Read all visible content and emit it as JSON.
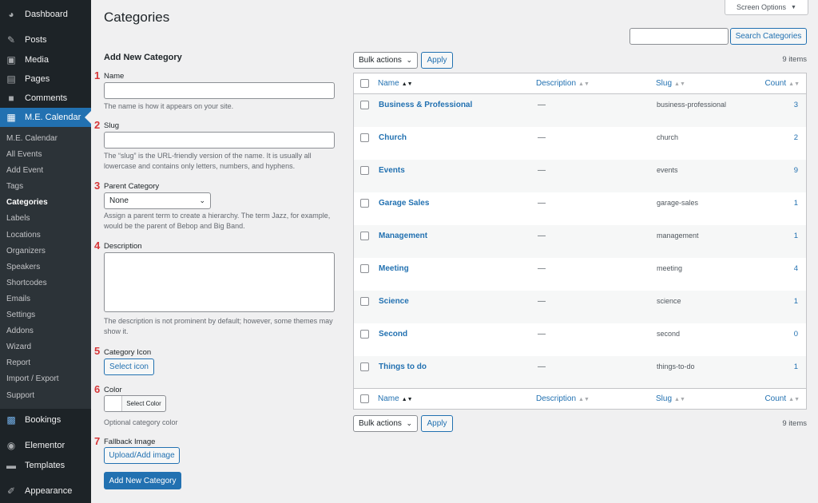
{
  "sidebar": {
    "top_items": [
      {
        "label": "Dashboard",
        "icon": "dashboard-icon"
      },
      {
        "label": "Posts",
        "icon": "pin-icon"
      },
      {
        "label": "Media",
        "icon": "media-icon"
      },
      {
        "label": "Pages",
        "icon": "pages-icon"
      },
      {
        "label": "Comments",
        "icon": "comment-icon"
      },
      {
        "label": "M.E. Calendar",
        "icon": "calendar-icon"
      }
    ],
    "sub_items": [
      "M.E. Calendar",
      "All Events",
      "Add Event",
      "Tags",
      "Categories",
      "Labels",
      "Locations",
      "Organizers",
      "Speakers",
      "Shortcodes",
      "Emails",
      "Settings",
      "Addons",
      "Wizard",
      "Report",
      "Import / Export",
      "Support"
    ],
    "bottom_items": [
      {
        "label": "Bookings",
        "icon": "bookings-icon"
      },
      {
        "label": "Elementor",
        "icon": "elementor-icon"
      },
      {
        "label": "Templates",
        "icon": "folder-icon"
      },
      {
        "label": "Appearance",
        "icon": "brush-icon"
      }
    ]
  },
  "header": {
    "title": "Categories",
    "screen_options": "Screen Options",
    "search_button": "Search Categories",
    "search_value": ""
  },
  "form": {
    "heading": "Add New Category",
    "name": {
      "number": "1",
      "label": "Name",
      "value": "",
      "help": "The name is how it appears on your site."
    },
    "slug": {
      "number": "2",
      "label": "Slug",
      "value": "",
      "help": "The “slug” is the URL-friendly version of the name. It is usually all lowercase and contains only letters, numbers, and hyphens."
    },
    "parent": {
      "number": "3",
      "label": "Parent Category",
      "selected": "None",
      "help": "Assign a parent term to create a hierarchy. The term Jazz, for example, would be the parent of Bebop and Big Band."
    },
    "description": {
      "number": "4",
      "label": "Description",
      "value": "",
      "help": "The description is not prominent by default; however, some themes may show it."
    },
    "icon": {
      "number": "5",
      "label": "Category Icon",
      "button": "Select icon"
    },
    "color": {
      "number": "6",
      "label": "Color",
      "button": "Select Color",
      "help": "Optional category color"
    },
    "fallback": {
      "number": "7",
      "label": "Fallback Image",
      "button": "Upload/Add image"
    },
    "submit": "Add New Category"
  },
  "table": {
    "bulk_actions": "Bulk actions",
    "apply": "Apply",
    "items_count": "9 items",
    "columns": {
      "name": "Name",
      "description": "Description",
      "slug": "Slug",
      "count": "Count"
    },
    "rows": [
      {
        "name": "Business & Professional",
        "description": "—",
        "slug": "business-professional",
        "count": "3"
      },
      {
        "name": "Church",
        "description": "—",
        "slug": "church",
        "count": "2"
      },
      {
        "name": "Events",
        "description": "—",
        "slug": "events",
        "count": "9"
      },
      {
        "name": "Garage Sales",
        "description": "—",
        "slug": "garage-sales",
        "count": "1"
      },
      {
        "name": "Management",
        "description": "—",
        "slug": "management",
        "count": "1"
      },
      {
        "name": "Meeting",
        "description": "—",
        "slug": "meeting",
        "count": "4"
      },
      {
        "name": "Science",
        "description": "—",
        "slug": "science",
        "count": "1"
      },
      {
        "name": "Second",
        "description": "—",
        "slug": "second",
        "count": "0"
      },
      {
        "name": "Things to do",
        "description": "—",
        "slug": "things-to-do",
        "count": "1"
      }
    ]
  },
  "colors": {
    "accent": "#2271b1",
    "sidebar_bg": "#1d2327",
    "number_red": "#d63638"
  }
}
